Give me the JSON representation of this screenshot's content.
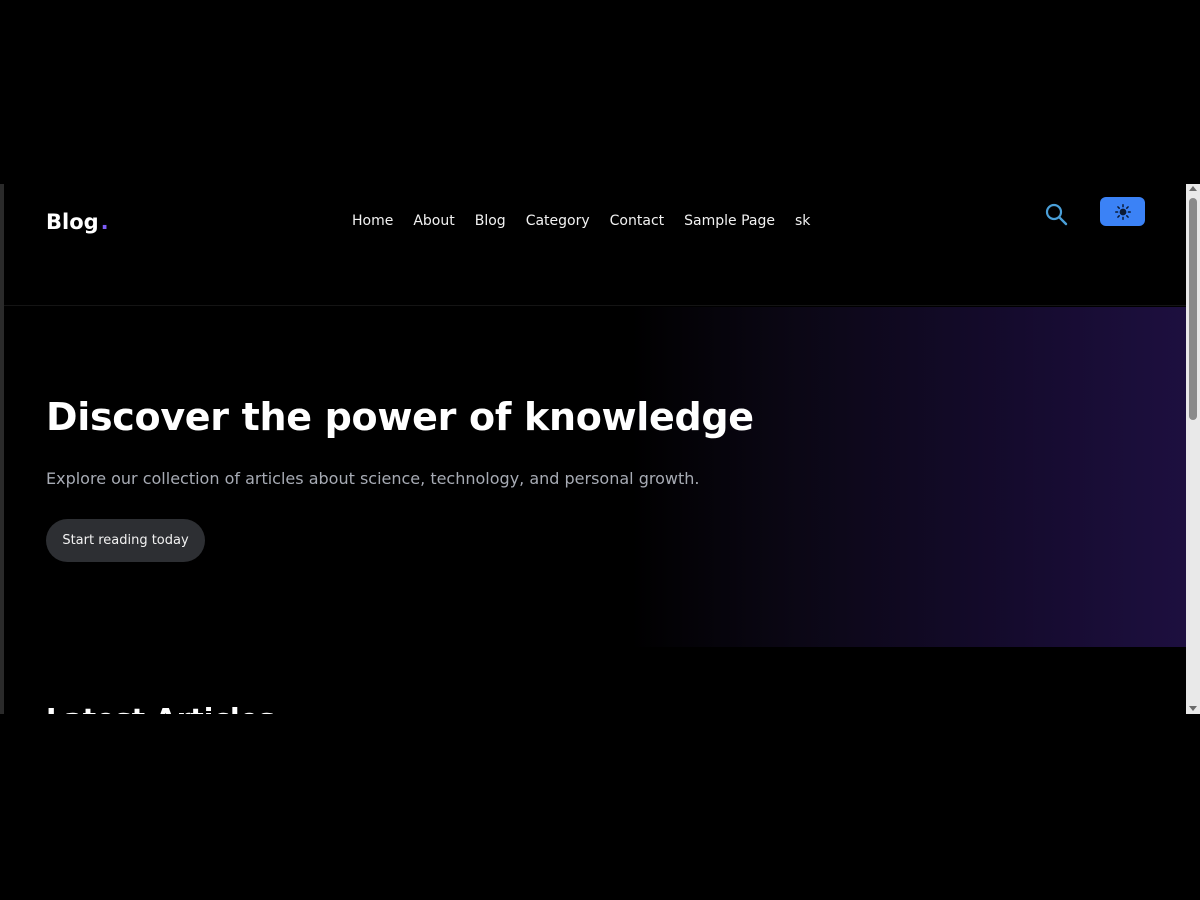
{
  "header": {
    "logo_text": "Blog",
    "logo_dot": ".",
    "nav": [
      {
        "label": "Home"
      },
      {
        "label": "About"
      },
      {
        "label": "Blog"
      },
      {
        "label": "Category"
      },
      {
        "label": "Contact"
      },
      {
        "label": "Sample Page"
      },
      {
        "label": "sk"
      }
    ],
    "search_icon": "search-icon",
    "theme_icon": "sun-icon"
  },
  "hero": {
    "title": "Discover the power of knowledge",
    "subtitle": "Explore our collection of articles about science, technology, and personal growth.",
    "cta_label": "Start reading today"
  },
  "latest": {
    "heading": "Latest Articles"
  },
  "colors": {
    "background": "#000000",
    "accent": "#3b82f6",
    "logo_dot": "#7c5cf5",
    "search_icon": "#4a9fd8",
    "button_bg": "#2d2f33",
    "subtitle_text": "#a7abb4"
  }
}
